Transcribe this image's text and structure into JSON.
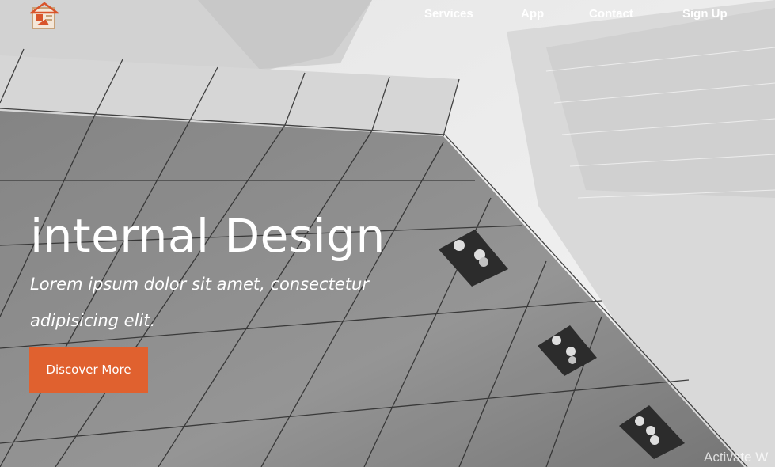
{
  "nav": {
    "logo_icon": "house-logo-icon",
    "items": [
      {
        "label": "Services"
      },
      {
        "label": "App"
      },
      {
        "label": "Contact"
      },
      {
        "label": "Sign Up"
      }
    ]
  },
  "hero": {
    "title": "internal Design",
    "subtitle": "Lorem ipsum dolor sit amet, consectetur adipisicing elit.",
    "cta_label": "Discover More"
  },
  "watermark": "Activate W",
  "colors": {
    "accent": "#e0612f",
    "text": "#ffffff",
    "logo_frame": "#c8a27a"
  }
}
